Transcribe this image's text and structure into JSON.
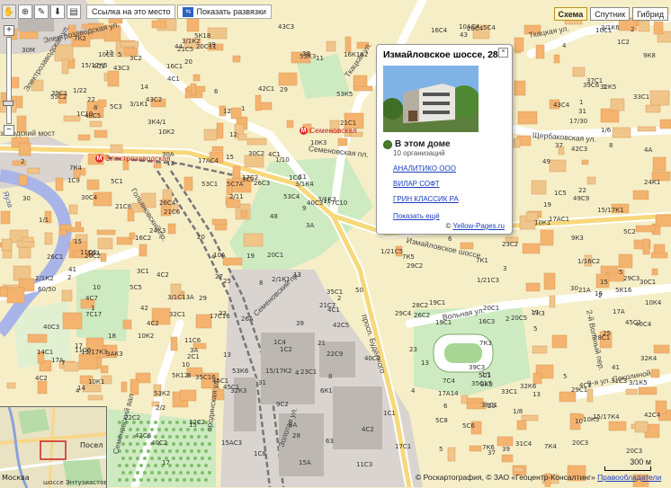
{
  "toolbar": {
    "link_button": "Ссылка на это место",
    "legend_button": "Показать развязки"
  },
  "map_types": [
    "Схема",
    "Спутник",
    "Гибрид"
  ],
  "active_map_type": "Схема",
  "metro": {
    "semenovskaya": "Семеновская",
    "elektrozavodskaya": "Электрозаводская"
  },
  "streets": {
    "elektrozavodskaya_ul": "Электрозаводская ул.",
    "elektrozavodskaya_ul2": "Электрозаводская ул.",
    "golyanovsky": "Гольяновский пр.",
    "semenovskaya_pl": "Семеновская пл.",
    "semenovsky_pr": "Семеновский пр.",
    "izmaylovskoe": "Измайловское шоссе",
    "tkatskaya": "Ткацкая ул.",
    "tkatskaya2": "Ткацкая ул.",
    "shcherbakovskaya": "Щербаковская ул.",
    "volnaya": "Вольная ул.",
    "budenogo": "просп. Будённого",
    "zolotaya": "Золотая ул.",
    "semenovsky_val": "Семеновский вал",
    "borodinskaya": "ородинская ул.",
    "zavodsky_most": "заводский мост",
    "sokolinoy": "9-я ул. Соколиной",
    "sokol2": "2-й Вольный пер.",
    "entuziastov": "шоссе Энтузиастов",
    "yauza": "Яуза",
    "moskva": "Москва",
    "posel": "Посел"
  },
  "balloon": {
    "title": "Измайловское шоссе, 28",
    "section_title": "В этом доме",
    "org_count": "10 организаций",
    "links": [
      "АНАЛИТИКО ООО",
      "ВИЛАР СОФТ",
      "ГРИН КЛАССИК РА"
    ],
    "more": "Показать ещё",
    "source_prefix": "©",
    "source": "Yellow-Pages.ru"
  },
  "scale": "300 м",
  "copyright": "© Роскартография, © ЗАО «Геоцентр-Консалтинг»",
  "copyright_link": "Правообладатели",
  "house_labels": [
    "1/21С3",
    "1/16С2",
    "21С5",
    "1/10",
    "1/8",
    "15/17К3",
    "15",
    "1/22",
    "15",
    "15/17К5",
    "15/17К4",
    "15/17К2",
    "15/17К1",
    "2",
    "1/21С5",
    "4С1",
    "4С2",
    "2",
    "4",
    "2/11",
    "16",
    "16С4",
    "16С1",
    "20С1",
    "20С2",
    "4С1",
    "4С2",
    "7С4",
    "3С2",
    "10А",
    "9К3",
    "5",
    "16С3",
    "16С2",
    "8",
    "18",
    "1",
    "20С4",
    "20С3",
    "4",
    "17",
    "3А",
    "17А",
    "10С2",
    "30С4",
    "30С1",
    "30С2",
    "10С1",
    "7К1",
    "7К3",
    "7К4",
    "7К2",
    "3С1",
    "3С2",
    "3",
    "6",
    "4С7",
    "5С1",
    "13",
    "42",
    "20",
    "17",
    "39",
    "48",
    "43С3",
    "43",
    "1",
    "45С1",
    "45С1",
    "43С4",
    "45С1",
    "49",
    "49С9",
    "5",
    "44",
    "6К1",
    "9К8",
    "9К9",
    "55С2",
    "40С4",
    "40С5",
    "40С2",
    "40С3",
    "42С5",
    "42С6",
    "42С4",
    "42С1",
    "42С3",
    "50",
    "60/50",
    "38",
    "38С1",
    "3/1С13А",
    "3/1К6",
    "3/1К5",
    "3/1К4",
    "1/6",
    "3К4/1",
    "3/1К3",
    "3/1К1",
    "3/1К2",
    "1/1",
    "2/1К2",
    "2/1К1",
    "11С4",
    "11С6",
    "11С3",
    "10К5",
    "10АС4",
    "10К4",
    "10К3",
    "10К2",
    "10К1",
    "1",
    "2/2",
    "13",
    "3АК3",
    "7С17",
    "2С1",
    "7К6",
    "7К4",
    "7К5",
    "7К3",
    "4С1",
    "7С10",
    "4С2",
    "5",
    "11С6",
    "5К18",
    "5К16",
    "5К12",
    "5С7А",
    "5С8",
    "5С6",
    "5С3",
    "5С5",
    "5С4",
    "5С1",
    "5С2",
    "22",
    "30",
    "8А",
    "20",
    "1С3",
    "1С6",
    "1С5",
    "1С4",
    "1С8",
    "1С10",
    "1С9",
    "1С2",
    "1С1",
    "1С2",
    "16К182",
    "1/1",
    "10К1",
    "10К2",
    "4А",
    "14С1",
    "22С2",
    "19С1",
    "12С2",
    "21А",
    "22",
    "20С11",
    "22С9",
    "20С5",
    "20С1",
    "17С16",
    "17А14",
    "17А",
    "19С1",
    "17/30",
    "10",
    "37С1",
    "17С2",
    "17С1",
    "26А",
    "21С8",
    "21С6",
    "29С2",
    "29С1",
    "15АС3",
    "15А",
    "29С3",
    "29С4",
    "20С3",
    "21С7",
    "9С2",
    "24К1",
    "24К3",
    "40С2",
    "40С3",
    "11",
    "12",
    "13",
    "4С3",
    "4С2",
    "4С1",
    "32К6",
    "32К5",
    "32К4",
    "32К3",
    "35С17",
    "33С1",
    "35С1",
    "39С1",
    "35С16",
    "39С6",
    "39С3",
    "17АС4",
    "17АС1",
    "19",
    "2",
    "26С4",
    "26С1",
    "26С3",
    "26С2",
    "28С2",
    "28С1",
    "28",
    "27",
    "29",
    "23С1",
    "23С2",
    "3А",
    "8",
    "13",
    "31",
    "33",
    "37",
    "39",
    "41",
    "43С2",
    "43С3",
    "41",
    "33С1",
    "32С1",
    "30",
    "30М",
    "4",
    "5",
    "23",
    "21",
    "7",
    "30А",
    "2",
    "13",
    "5",
    "9",
    "11",
    "15",
    "29",
    "25",
    "19",
    "17",
    "21С1",
    "31С3",
    "31С4",
    "53С1",
    "53С4",
    "53К6",
    "53К5",
    "53К3",
    "53К2",
    "63",
    "1",
    "11",
    "15",
    "14",
    "12",
    "10",
    "8",
    "6",
    "4",
    "2",
    "39",
    "37",
    "8",
    "14",
    "25",
    "29",
    "31",
    "12",
    "10",
    "8",
    "6",
    "2",
    "4"
  ]
}
